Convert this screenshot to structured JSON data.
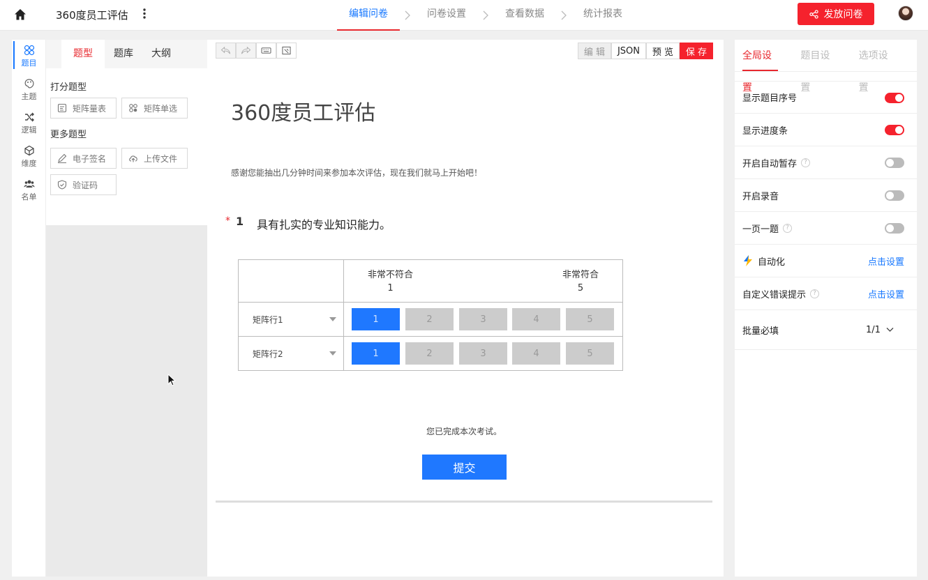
{
  "header": {
    "title": "360度员工评估",
    "steps": [
      "编辑问卷",
      "问卷设置",
      "查看数据",
      "统计报表"
    ],
    "publish_label": "发放问卷"
  },
  "rail": [
    {
      "label": "题目",
      "icon": "question-icon"
    },
    {
      "label": "主题",
      "icon": "palette-icon"
    },
    {
      "label": "逻辑",
      "icon": "shuffle-icon"
    },
    {
      "label": "维度",
      "icon": "cube-icon"
    },
    {
      "label": "名单",
      "icon": "people-icon"
    }
  ],
  "qpanel": {
    "tabs": [
      "题型",
      "题库",
      "大纲"
    ],
    "groups": [
      {
        "title": "打分题型",
        "items": [
          "矩阵量表",
          "矩阵单选"
        ]
      },
      {
        "title": "更多题型",
        "items": [
          "电子签名",
          "上传文件",
          "验证码"
        ]
      }
    ]
  },
  "toolbar": {
    "edit": "编 辑",
    "json": "JSON",
    "preview": "预 览",
    "save": "保 存"
  },
  "survey": {
    "title": "360度员工评估",
    "description": "感谢您能抽出几分钟时间来参加本次评估，现在我们就马上开始吧！",
    "question": {
      "required_mark": "*",
      "number": "1",
      "text": "具有扎实的专业知识能力。",
      "scale_low_label": "非常不符合",
      "scale_low_value": "1",
      "scale_high_label": "非常符合",
      "scale_high_value": "5",
      "options": [
        "1",
        "2",
        "3",
        "4",
        "5"
      ],
      "rows": [
        {
          "label": "矩阵行1",
          "selected": "1"
        },
        {
          "label": "矩阵行2",
          "selected": "1"
        }
      ]
    },
    "finish_text": "您已完成本次考试。",
    "submit_label": "提交"
  },
  "settings": {
    "tabs": [
      "全局设置",
      "题目设置",
      "选项设置"
    ],
    "rows": [
      {
        "label": "显示题目序号",
        "type": "toggle",
        "on": true,
        "help": false
      },
      {
        "label": "显示进度条",
        "type": "toggle",
        "on": true,
        "help": false
      },
      {
        "label": "开启自动暂存",
        "type": "toggle",
        "on": false,
        "help": true
      },
      {
        "label": "开启录音",
        "type": "toggle",
        "on": false,
        "help": false
      },
      {
        "label": "一页一题",
        "type": "toggle",
        "on": false,
        "help": true
      }
    ],
    "automation_label": "自动化",
    "automation_link": "点击设置",
    "error_tip_label": "自定义错误提示",
    "error_tip_link": "点击设置",
    "batch_required_label": "批量必填",
    "batch_required_value": "1/1",
    "help_glyph": "?"
  },
  "colors": {
    "accent_red": "#f5222d",
    "accent_blue": "#1f78ff"
  }
}
